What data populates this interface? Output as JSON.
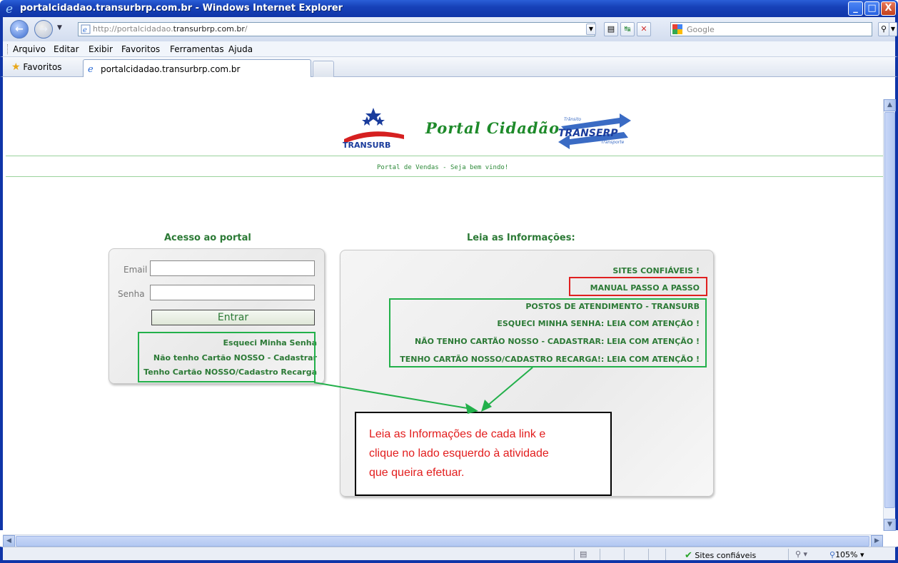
{
  "window": {
    "title": "portalcidadao.transurbrp.com.br - Windows Internet Explorer",
    "minimize": "_",
    "maximize": "□",
    "close": "X"
  },
  "address": {
    "url_prefix": "http://portalcidadao.",
    "url_domain": "transurbrp.com.br",
    "url_suffix": "/",
    "search_placeholder": "Google"
  },
  "menu": [
    "Arquivo",
    "Editar",
    "Exibir",
    "Favoritos",
    "Ferramentas",
    "Ajuda"
  ],
  "favorites": {
    "label": "Favoritos",
    "tab_title": "portalcidadao.transurbrp.com.br"
  },
  "page": {
    "title": "Portal Cidadão",
    "logo_left_text": "TRANSURB",
    "logo_right_top": "Trânsito",
    "logo_right_main": "TRANSERP",
    "logo_right_bottom": "Transporte",
    "welcome": "Portal de Vendas - Seja bem vindo!",
    "access_heading": "Acesso ao portal",
    "info_heading": "Leia as Informações:",
    "email_label": "Email",
    "password_label": "Senha",
    "login_button": "Entrar",
    "login_links": [
      "Esqueci Minha Senha",
      "Não tenho Cartão NOSSO - Cadastrar",
      "Tenho Cartão NOSSO/Cadastro Recarga"
    ],
    "info_links": [
      "SITES CONFIÁVEIS !",
      "MANUAL PASSO A PASSO",
      "POSTOS DE ATENDIMENTO - TRANSURB",
      "ESQUECI MINHA SENHA: LEIA COM ATENÇÃO !",
      "NÃO TENHO CARTÃO NOSSO - CADASTRAR: LEIA COM ATENÇÃO !",
      "TENHO CARTÃO NOSSO/CADASTRO RECARGA!: LEIA COM ATENÇÃO !"
    ],
    "callout_lines": [
      "Leia as Informações de cada link e",
      "clique no lado esquerdo à atividade",
      "que queira efetuar."
    ]
  },
  "status": {
    "zone": "Sites confiáveis",
    "zoom": "105%"
  },
  "colors": {
    "accent_green": "#2c7a36",
    "highlight_green": "#22b04a",
    "highlight_red": "#e02020",
    "callout_text": "#e21d1d"
  }
}
